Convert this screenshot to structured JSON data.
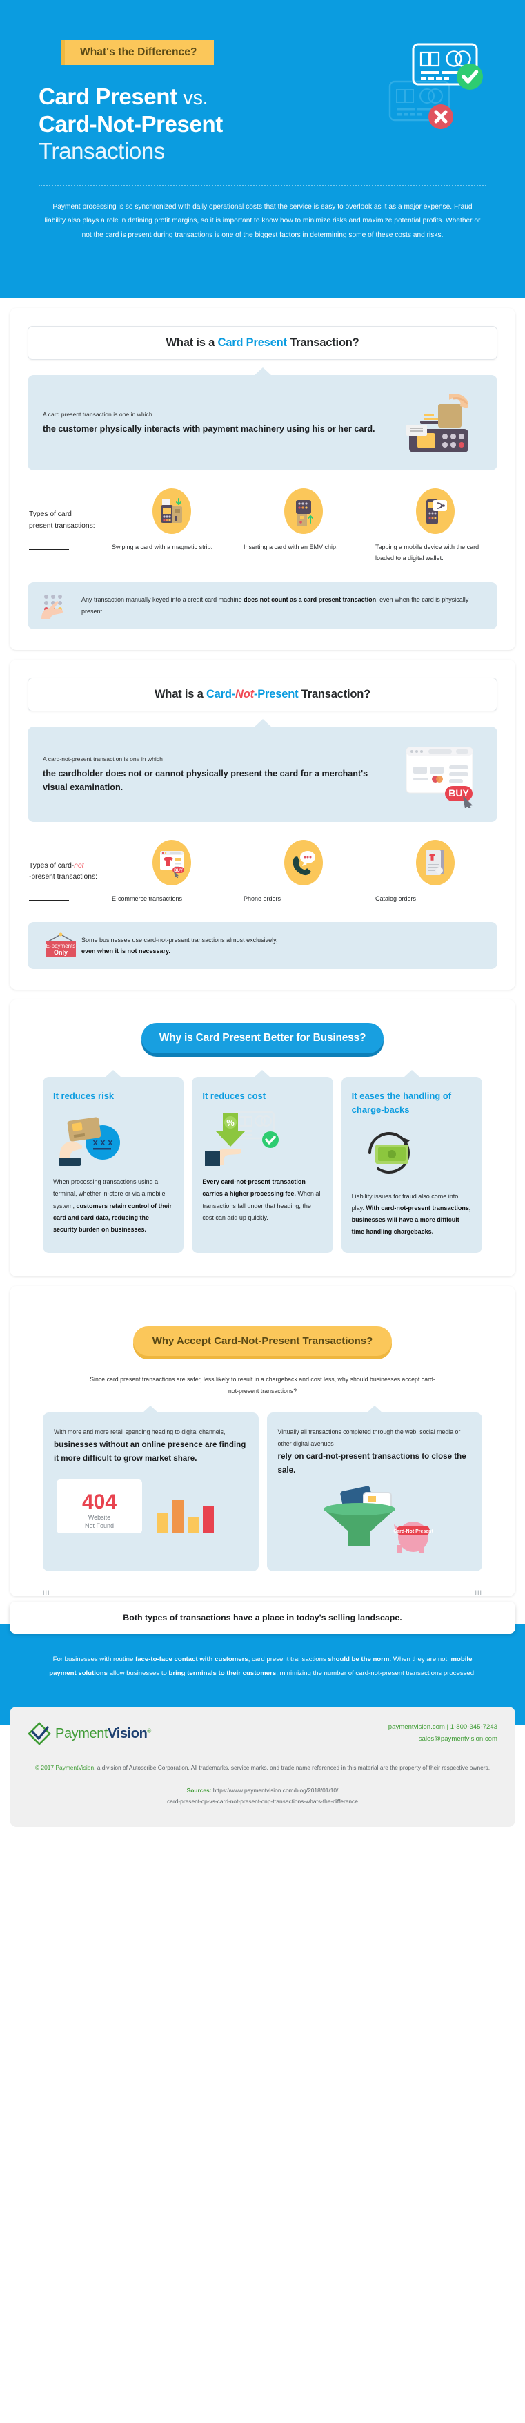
{
  "hero": {
    "eyebrow": "What's the Difference?",
    "title_line1_bold": "Card Present",
    "title_vs": "vs.",
    "title_line2_bold": "Card-Not-Present",
    "title_line3_light": "Transactions",
    "paragraph": "Payment processing is so synchronized with daily operational costs that the service is easy to overlook as it as a major expense. Fraud liability also plays a role in defining profit margins, so it is important to know how to minimize risks and maximize potential profits. Whether or not the card is present during transactions is one of the biggest factors in determining some of these costs and risks.",
    "accent_blue": "#0b9ce0",
    "accent_yellow": "#fbc75a"
  },
  "cp_section": {
    "title_pre": "What is a ",
    "title_accent": "Card Present",
    "title_post": " Transaction?",
    "bubble_lead": "A card present transaction is one in which",
    "bubble_main": "the customer physically interacts with payment machinery using his or her card.",
    "types_label_line1": "Types of card",
    "types_label_line2": "present transactions:",
    "types": [
      {
        "icon": "card-swipe-terminal-icon",
        "caption": "Swiping a card with a magnetic strip."
      },
      {
        "icon": "emv-chip-insert-icon",
        "caption": "Inserting a card with an EMV chip."
      },
      {
        "icon": "contactless-tap-icon",
        "caption": "Tapping a mobile device with the card loaded to a digital wallet."
      }
    ],
    "note_pre": "Any transaction manually keyed into a credit card machine ",
    "note_bold": "does not count as a card present transaction",
    "note_post": ", even when the card is physically present."
  },
  "cnp_section": {
    "title_pre": "What is a ",
    "title_accent_a": "Card-",
    "title_accent_b": "Not",
    "title_accent_c": "-Present",
    "title_post": " Transaction?",
    "bubble_lead": "A card-not-present transaction is one in which",
    "bubble_main": "the cardholder does not or cannot physically present the card for a merchant's visual examination.",
    "types_label_line1_pre": "Types of card-",
    "types_label_line1_em": "not",
    "types_label_line2": "-present transactions:",
    "types": [
      {
        "icon": "ecommerce-browser-buy-icon",
        "caption": "E-commerce transactions"
      },
      {
        "icon": "phone-order-icon",
        "caption": "Phone orders"
      },
      {
        "icon": "catalog-order-icon",
        "caption": "Catalog orders"
      }
    ],
    "note_badge_line1": "E-payments",
    "note_badge_line2": "Only",
    "note_pre": "Some businesses use card-not-present transactions almost exclusively, ",
    "note_bold": "even when it is not necessary."
  },
  "why_cp": {
    "cta": "Why is Card Present Better for Business?",
    "cards": [
      {
        "heading": "It reduces risk",
        "icon": "hand-holding-card-secure-icon",
        "body_pre": "When processing transactions using a terminal, whether in-store or via a mobile system, ",
        "body_bold": "customers retain control of their card and card data, reducing the security burden on businesses.",
        "body_post": ""
      },
      {
        "heading": "It reduces cost",
        "icon": "percent-discount-card-icon",
        "body_pre": "",
        "body_bold": "Every card-not-present transaction carries a higher processing fee.",
        "body_post": " When all transactions fall under that heading, the cost can add up quickly."
      },
      {
        "heading": "It eases the handling of charge-backs",
        "icon": "chargeback-refund-icon",
        "body_pre": "Liability issues for fraud also come into play. ",
        "body_bold": "With card-not-present transactions, businesses will have a more difficult time handling chargebacks.",
        "body_post": ""
      }
    ]
  },
  "why_cnp": {
    "cta": "Why Accept Card-Not-Present Transactions?",
    "subquestion": "Since card present transactions are safer, less likely to result in a chargeback and cost less, why should businesses accept card-not-present transactions?",
    "cards": [
      {
        "icon": "error-404-chart-icon",
        "lead": "With more and more retail spending heading to digital channels, ",
        "strong": "businesses without an online presence are finding it more difficult to grow market share.",
        "art_label_big": "404",
        "art_label_sub1": "Website",
        "art_label_sub2": "Not Found"
      },
      {
        "icon": "sales-funnel-card-not-present-icon",
        "lead": "Virtually all transactions completed through the web, social media or other digital avenues ",
        "strong": "rely on card-not-present transactions to close the sale.",
        "art_badge": "Card-Not Present"
      }
    ],
    "tick_left": "III",
    "tick_right": "III"
  },
  "banner": "Both types of transactions have a place in today's selling landscape.",
  "blue_footer": {
    "line_pre": "For businesses with routine ",
    "line_b1": "face-to-face contact with customers",
    "line_mid1": ", card present transactions ",
    "line_b2": "should be the norm",
    "line_mid2": ". When they are not, ",
    "line_b3": "mobile payment solutions",
    "line_mid3": " allow businesses to ",
    "line_b4": "bring terminals to their customers",
    "line_end": ", minimizing the number of card-not-present transactions processed."
  },
  "footer": {
    "logo_part1": "Payment",
    "logo_part2": "Vision",
    "logo_tm": "®",
    "contact_line1": "paymentvision.com | 1-800-345-7243",
    "contact_line2": "sales@paymentvision.com",
    "legal_mark": "©",
    "legal_company": " 2017 PaymentVision",
    "legal_rest": ", a division of Autoscribe Corporation. All trademarks, service marks, and trade name referenced in this material are the property of their respective owners.",
    "sources_label": "Sources:",
    "sources_url_line1": " https://www.paymentvision.com/blog/2018/01/10/",
    "sources_url_line2": "card-present-cp-vs-card-not-present-cnp-transactions-whats-the-difference",
    "brand_green": "#3f9c35",
    "brand_navy": "#1c3f70"
  }
}
